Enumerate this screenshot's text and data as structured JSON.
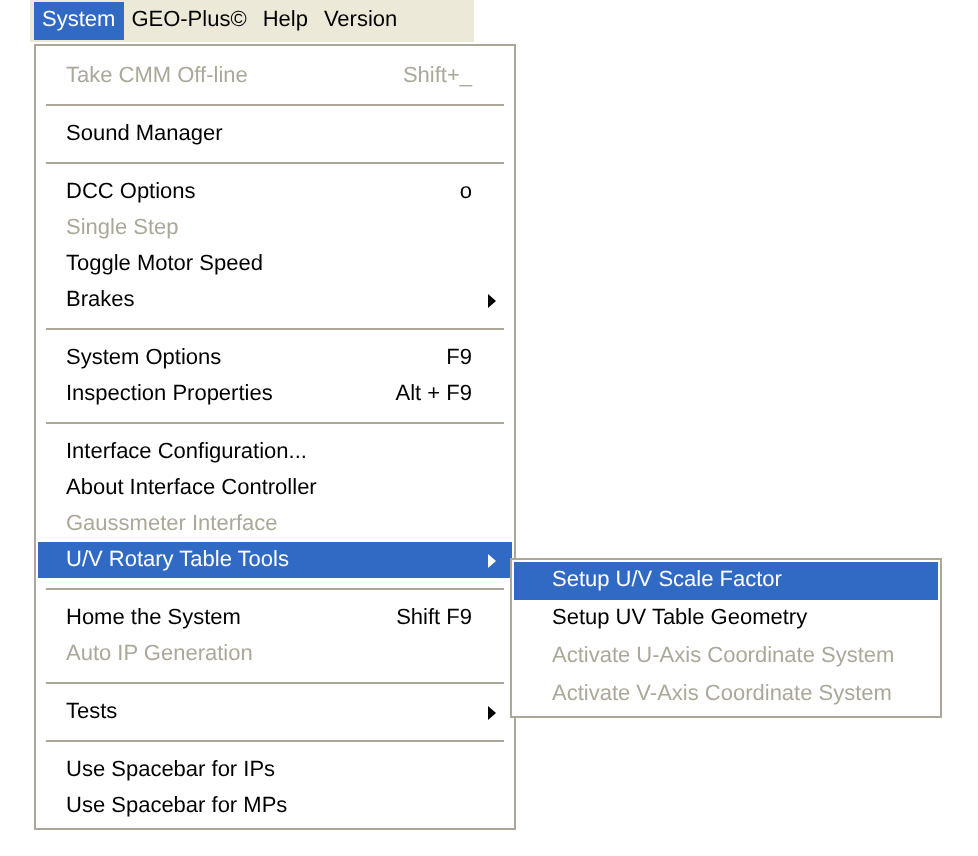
{
  "menubar": [
    {
      "label": "System",
      "selected": true
    },
    {
      "label": "GEO-Plus©",
      "selected": false
    },
    {
      "label": "Help",
      "selected": false
    },
    {
      "label": "Version",
      "selected": false
    }
  ],
  "menu": {
    "sections": [
      [
        {
          "label": "Take CMM Off-line",
          "shortcut": "Shift+_",
          "disabled": true,
          "selected": false,
          "has_submenu": false
        }
      ],
      [
        {
          "label": "Sound Manager",
          "disabled": false,
          "selected": false,
          "has_submenu": false
        }
      ],
      [
        {
          "label": "DCC Options",
          "shortcut": "o",
          "disabled": false,
          "selected": false,
          "has_submenu": false
        },
        {
          "label": "Single Step",
          "disabled": true,
          "selected": false,
          "has_submenu": false
        },
        {
          "label": "Toggle Motor Speed",
          "disabled": false,
          "selected": false,
          "has_submenu": false
        },
        {
          "label": "Brakes",
          "disabled": false,
          "selected": false,
          "has_submenu": true
        }
      ],
      [
        {
          "label": "System Options",
          "shortcut": "F9",
          "disabled": false,
          "selected": false,
          "has_submenu": false
        },
        {
          "label": "Inspection Properties",
          "shortcut": "Alt + F9",
          "disabled": false,
          "selected": false,
          "has_submenu": false
        }
      ],
      [
        {
          "label": "Interface Configuration...",
          "disabled": false,
          "selected": false,
          "has_submenu": false
        },
        {
          "label": "About Interface Controller",
          "disabled": false,
          "selected": false,
          "has_submenu": false
        },
        {
          "label": "Gaussmeter Interface",
          "disabled": true,
          "selected": false,
          "has_submenu": false
        },
        {
          "label": "U/V Rotary Table Tools",
          "disabled": false,
          "selected": true,
          "has_submenu": true
        }
      ],
      [
        {
          "label": "Home the System",
          "shortcut": "Shift F9",
          "disabled": false,
          "selected": false,
          "has_submenu": false
        },
        {
          "label": "Auto IP Generation",
          "disabled": true,
          "selected": false,
          "has_submenu": false
        }
      ],
      [
        {
          "label": "Tests",
          "disabled": false,
          "selected": false,
          "has_submenu": true
        }
      ],
      [
        {
          "label": "Use Spacebar for IPs",
          "disabled": false,
          "selected": false,
          "has_submenu": false
        },
        {
          "label": "Use Spacebar for MPs",
          "disabled": false,
          "selected": false,
          "has_submenu": false
        }
      ]
    ]
  },
  "submenu": {
    "items": [
      {
        "label": "Setup U/V Scale Factor",
        "disabled": false,
        "selected": true
      },
      {
        "label": "Setup UV Table Geometry",
        "disabled": false,
        "selected": false
      },
      {
        "label": "Activate U-Axis Coordinate System",
        "disabled": true,
        "selected": false
      },
      {
        "label": "Activate V-Axis Coordinate System",
        "disabled": true,
        "selected": false
      }
    ]
  }
}
